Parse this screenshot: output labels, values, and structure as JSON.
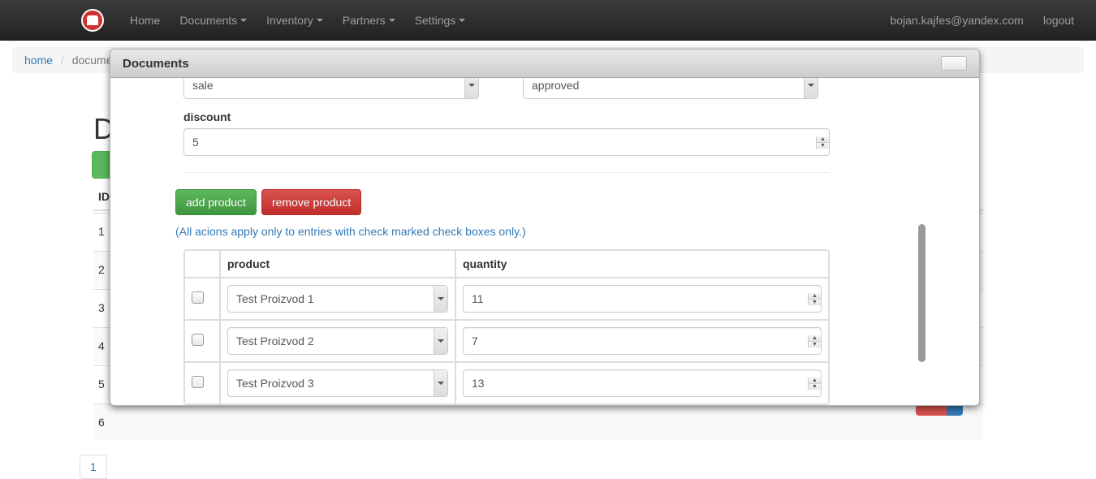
{
  "navbar": {
    "home": "Home",
    "documents": "Documents",
    "inventory": "Inventory",
    "partners": "Partners",
    "settings": "Settings",
    "user_email": "bojan.kajfes@yandex.com",
    "logout": "logout"
  },
  "breadcrumb": {
    "home": "home",
    "current": "docume"
  },
  "background": {
    "title_letter": "D",
    "id_header": "ID",
    "rows": [
      "1",
      "2",
      "3",
      "4",
      "5",
      "6"
    ],
    "pager": "1"
  },
  "modal": {
    "title": "Documents",
    "type_select": "sale",
    "status_select": "approved",
    "discount_label": "discount",
    "discount_value": "5",
    "add_product_btn": "add product",
    "remove_product_btn": "remove product",
    "hint": "(All acions apply only to entries with check marked check boxes only.)",
    "table": {
      "product_header": "product",
      "quantity_header": "quantity",
      "rows": [
        {
          "product": "Test Proizvod 1",
          "quantity": "11"
        },
        {
          "product": "Test Proizvod 2",
          "quantity": "7"
        },
        {
          "product": "Test Proizvod 3",
          "quantity": "13"
        }
      ]
    }
  }
}
